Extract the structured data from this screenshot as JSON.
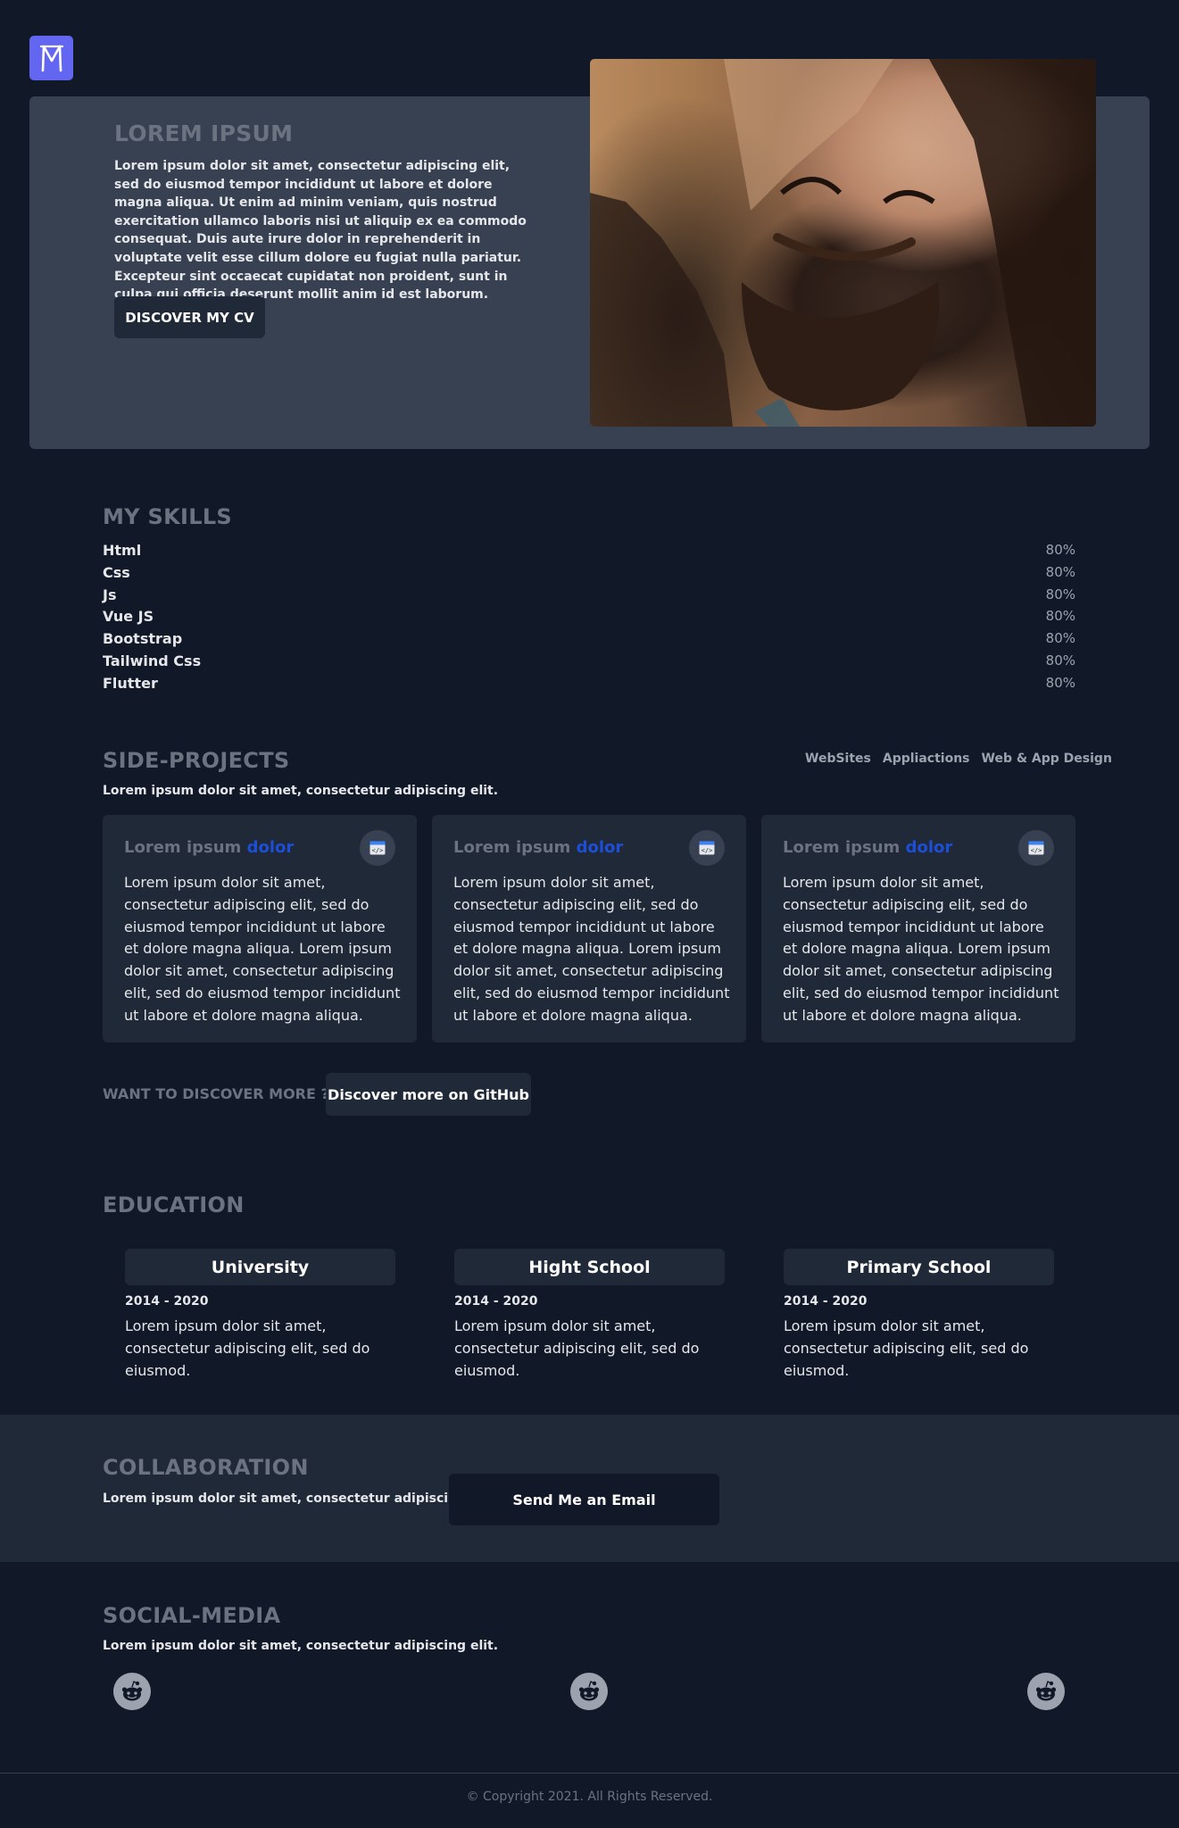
{
  "brand": {
    "logo_letter": "M",
    "logo_color": "#6366f1"
  },
  "hero": {
    "title": "LOREM IPSUM",
    "text": "Lorem ipsum dolor sit amet, consectetur adipiscing elit, sed do eiusmod tempor incididunt ut labore et dolore magna aliqua. Ut enim ad minim veniam, quis nostrud exercitation ullamco laboris nisi ut aliquip ex ea commodo consequat. Duis aute irure dolor in reprehenderit in voluptate velit esse cillum dolore eu fugiat nulla pariatur. Excepteur sint occaecat cupidatat non proident, sunt in culpa qui officia deserunt mollit anim id est laborum.",
    "button_label": "DISCOVER MY CV"
  },
  "skills": {
    "title": "MY SKILLS",
    "items": [
      {
        "name": "Html",
        "percent": "80%"
      },
      {
        "name": "Css",
        "percent": "80%"
      },
      {
        "name": "Js",
        "percent": "80%"
      },
      {
        "name": "Vue JS",
        "percent": "80%"
      },
      {
        "name": "Bootstrap",
        "percent": "80%"
      },
      {
        "name": "Tailwind Css",
        "percent": "80%"
      },
      {
        "name": "Flutter",
        "percent": "80%"
      }
    ]
  },
  "projects": {
    "title": "SIDE-PROJECTS",
    "lead": "Lorem ipsum dolor sit amet, consectetur adipiscing elit.",
    "filters": [
      "WebSites",
      "Appliactions",
      "Web & App Design"
    ],
    "cards": [
      {
        "title": "Lorem ipsum",
        "accent": "dolor",
        "icon": "code-window-icon",
        "body": "Lorem ipsum dolor sit amet, consectetur adipiscing elit, sed do eiusmod tempor incididunt ut labore et dolore magna aliqua. Lorem ipsum dolor sit amet, consectetur adipiscing elit, sed do eiusmod tempor incididunt ut labore et dolore magna aliqua."
      },
      {
        "title": "Lorem ipsum",
        "accent": "dolor",
        "icon": "code-window-icon",
        "body": "Lorem ipsum dolor sit amet, consectetur adipiscing elit, sed do eiusmod tempor incididunt ut labore et dolore magna aliqua. Lorem ipsum dolor sit amet, consectetur adipiscing elit, sed do eiusmod tempor incididunt ut labore et dolore magna aliqua."
      },
      {
        "title": "Lorem ipsum",
        "accent": "dolor",
        "icon": "code-window-icon",
        "body": "Lorem ipsum dolor sit amet, consectetur adipiscing elit, sed do eiusmod tempor incididunt ut labore et dolore magna aliqua. Lorem ipsum dolor sit amet, consectetur adipiscing elit, sed do eiusmod tempor incididunt ut labore et dolore magna aliqua."
      }
    ],
    "accent_color": "#1d4ed8",
    "more_label": "WANT TO DISCOVER MORE ?",
    "github_button": "Discover more on GitHub"
  },
  "education": {
    "title": "EDUCATION",
    "items": [
      {
        "name": "University",
        "years": "2014 - 2020",
        "text": "Lorem ipsum dolor sit amet, consectetur adipiscing elit, sed do eiusmod."
      },
      {
        "name": "Hight School",
        "years": "2014 - 2020",
        "text": "Lorem ipsum dolor sit amet, consectetur adipiscing elit, sed do eiusmod."
      },
      {
        "name": "Primary School",
        "years": "2014 - 2020",
        "text": "Lorem ipsum dolor sit amet, consectetur adipiscing elit, sed do eiusmod."
      }
    ]
  },
  "collaboration": {
    "title": "COLLABORATION",
    "lead": "Lorem ipsum dolor sit amet, consectetur adipiscing elit.",
    "button_label": "Send Me an Email"
  },
  "social": {
    "title": "SOCIAL-MEDIA",
    "lead": "Lorem ipsum dolor sit amet, consectetur adipiscing elit.",
    "icons": [
      "reddit-icon",
      "reddit-icon",
      "reddit-icon"
    ]
  },
  "footer": {
    "copyright": "© Copyright 2021. All Rights Reserved."
  },
  "colors": {
    "background": "#111827",
    "panel": "#1f2937",
    "hero_panel": "#374151",
    "muted_heading": "#6b7280"
  }
}
